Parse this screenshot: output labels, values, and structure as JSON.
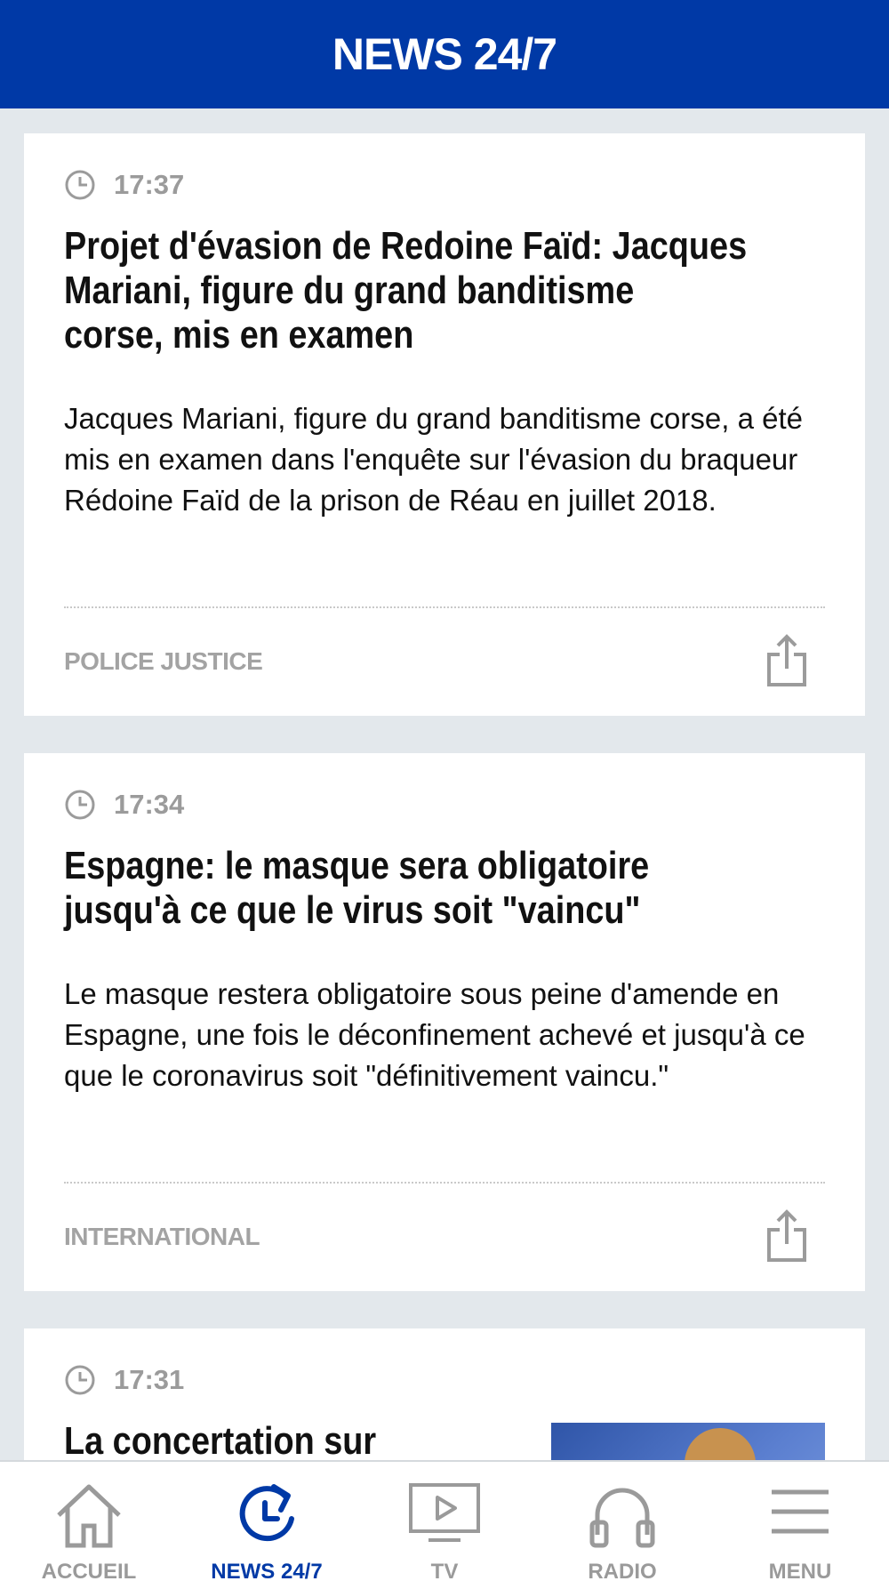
{
  "header": {
    "title": "NEWS 24/7"
  },
  "articles": [
    {
      "time": "17:37",
      "title_lines": [
        "Projet d'évasion de Redoine Faïd: Jacques",
        "Mariani, figure du grand banditisme",
        "corse, mis en examen"
      ],
      "summary": "Jacques Mariani, figure du grand banditisme corse, a été mis en examen dans l'enquête sur l'évasion du braqueur Rédoine Faïd de la prison de Réau en juillet 2018.",
      "category": "POLICE JUSTICE"
    },
    {
      "time": "17:34",
      "title_lines": [
        "Espagne: le masque sera obligatoire",
        "jusqu'à ce que le virus soit \"vaincu\""
      ],
      "summary": "Le masque restera obligatoire sous peine d'amende en Espagne, une fois le déconfinement achevé et jusqu'à ce que le coronavirus soit \"définitivement vaincu.\"",
      "category": "INTERNATIONAL"
    },
    {
      "time": "17:31",
      "title_lines": [
        "La concertation sur"
      ]
    }
  ],
  "tabbar": {
    "items": [
      {
        "label": "ACCUEIL",
        "icon": "home-icon",
        "active": false
      },
      {
        "label": "NEWS 24/7",
        "icon": "news-refresh-icon",
        "active": true
      },
      {
        "label": "TV",
        "icon": "tv-play-icon",
        "active": false
      },
      {
        "label": "RADIO",
        "icon": "headphones-icon",
        "active": false
      },
      {
        "label": "MENU",
        "icon": "hamburger-menu-icon",
        "active": false
      }
    ]
  },
  "colors": {
    "brand": "#0039a6",
    "background": "#e3e8ec",
    "muted_text": "#9b9b9b"
  }
}
